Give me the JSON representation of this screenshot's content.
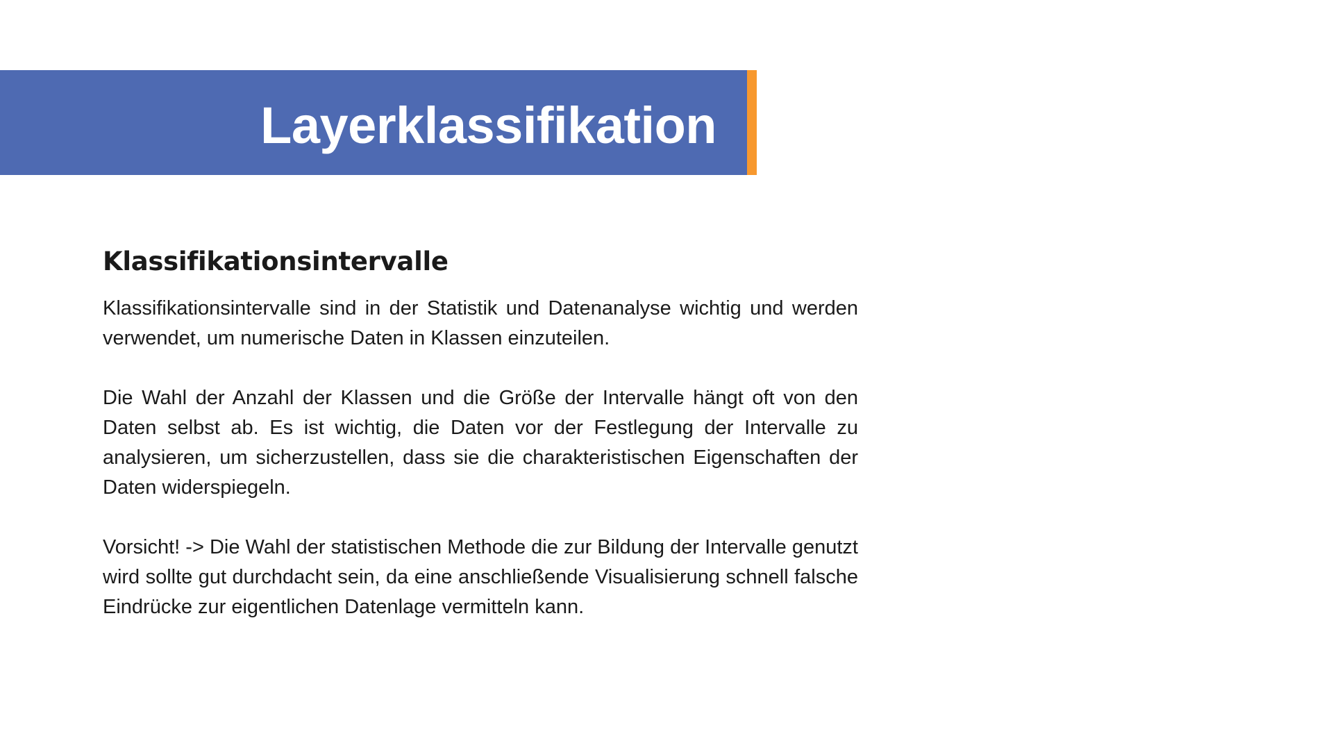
{
  "title": "Layerklassifikation",
  "section": {
    "heading": "Klassifikationsintervalle",
    "paragraphs": [
      "Klassifikationsintervalle sind in der Statistik und Datenanalyse wichtig und werden verwendet, um numerische Daten in Klassen einzuteilen.",
      "Die Wahl der Anzahl der Klassen und die Größe der Intervalle hängt oft von den Daten selbst ab. Es ist wichtig, die Daten vor der Festlegung der Intervalle zu analysieren, um sicherzustellen, dass sie die charakteristischen Eigenschaften der Daten widerspiegeln.",
      "Vorsicht! -> Die Wahl der statistischen Methode die zur Bildung der Intervalle genutzt wird sollte gut durchdacht sein, da eine anschließende Visualisierung schnell falsche Eindrücke zur eigentlichen Datenlage vermitteln kann."
    ]
  },
  "colors": {
    "banner": "#4e6ab2",
    "accent": "#f7982e",
    "text": "#1a1a1a",
    "background": "#ffffff"
  }
}
